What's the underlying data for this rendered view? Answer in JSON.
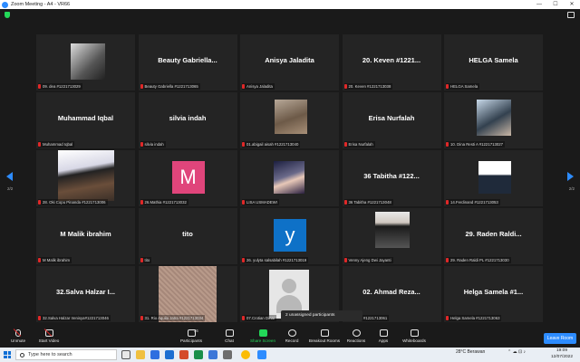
{
  "window": {
    "title": "Zoom Meeting - A4 - VR66",
    "controls": [
      "—",
      "☐",
      "✕"
    ]
  },
  "pager": {
    "left": "2/2",
    "right": "2/2"
  },
  "tiles": [
    {
      "id": "t0",
      "name": "",
      "caption": "09. dea #1221713029",
      "pic": "photo1"
    },
    {
      "id": "t1",
      "name": "Beauty  Gabriella...",
      "caption": "Beauty Gabriella #1221713065",
      "pic": ""
    },
    {
      "id": "t2",
      "name": "Anisya Jaladita",
      "caption": "Anisya Jaladita",
      "pic": ""
    },
    {
      "id": "t3",
      "name": "20. Keven #1221...",
      "caption": "20. Keven #1221713038",
      "pic": ""
    },
    {
      "id": "t4",
      "name": "HELGA Samela",
      "caption": "HELGA Samela",
      "pic": ""
    },
    {
      "id": "t5",
      "name": "Muhammad Iqbal",
      "caption": "Muhammad Iqbal",
      "pic": ""
    },
    {
      "id": "t6",
      "name": "silvia indah",
      "caption": "silvia indah",
      "pic": ""
    },
    {
      "id": "t7",
      "name": "",
      "caption": "01.abigail aisah #1221713040",
      "pic": "photo2"
    },
    {
      "id": "t8",
      "name": "Erisa Nurfalah",
      "caption": "Erisa Nurfalah",
      "pic": ""
    },
    {
      "id": "t9",
      "name": "",
      "caption": "10. Dina Resti A #1221713027",
      "pic": "photo3"
    },
    {
      "id": "t10",
      "name": "",
      "caption": "28. Oki Copu Pinanda #1221713006",
      "pic": "photo4"
    },
    {
      "id": "t11",
      "name": "",
      "caption": "26.Mathia #1221713032",
      "pic": "letter-m",
      "letter": "M"
    },
    {
      "id": "t12",
      "name": "",
      "caption": "LISA USMADEWI",
      "pic": "photo5"
    },
    {
      "id": "t13",
      "name": "36 Tabitha #122...",
      "caption": "36 Tabitha #1221713048",
      "pic": ""
    },
    {
      "id": "t14",
      "name": "",
      "caption": "14.Ferdinand #1221713053",
      "pic": "photo6"
    },
    {
      "id": "t15",
      "name": "M Malik ibrahim",
      "caption": "M Malik ibrahim",
      "pic": ""
    },
    {
      "id": "t16",
      "name": "tito",
      "caption": "tito",
      "pic": ""
    },
    {
      "id": "t17",
      "name": "",
      "caption": "26. yulyta salsabilah #1221713019",
      "pic": "letter-y",
      "letter": "y"
    },
    {
      "id": "t18",
      "name": "",
      "caption": "Venny Ajeng Dwi Jayanti",
      "pic": "photo7"
    },
    {
      "id": "t19",
      "name": "29. Raden Raldi...",
      "caption": "29. Raden Raldi PL #1221713030",
      "pic": ""
    },
    {
      "id": "t20",
      "name": "32.Salva Halzar I...",
      "caption": "32.Salva Halzar Irenisya#1221713046",
      "pic": ""
    },
    {
      "id": "t21",
      "name": "",
      "caption": "31. Rio Aquila Jatra #1221713034",
      "pic": "photo8"
    },
    {
      "id": "t22",
      "name": "",
      "caption": "07.Crotian Dinai",
      "pic": "avatar"
    },
    {
      "id": "t23",
      "name": "02. Ahmad Reza...",
      "caption": "d Reza* #1221713061",
      "pic": ""
    },
    {
      "id": "t24",
      "name": "Helga Samela #1...",
      "caption": "Helga Samela #1221713063",
      "pic": ""
    }
  ],
  "popup": {
    "text": "2 unassigned participants"
  },
  "toolbar": {
    "unmute": "Unmute",
    "start_video": "Start Video",
    "participants": "Participants",
    "participants_count": "36",
    "chat": "Chat",
    "share_screen": "Share Screen",
    "record": "Record",
    "breakout_rooms": "Breakout Rooms",
    "reactions": "Reactions",
    "apps": "Apps",
    "whiteboards": "Whiteboards",
    "leave": "Leave Room"
  },
  "taskbar": {
    "search_placeholder": "Type here to search",
    "weather": "28°C  Berawan",
    "time": "19:09",
    "date": "12/07/2022"
  },
  "colors": {
    "accent": "#2d8cff",
    "share_green": "#23d959",
    "muted_red": "#e02828",
    "tile_bg": "#242424"
  }
}
